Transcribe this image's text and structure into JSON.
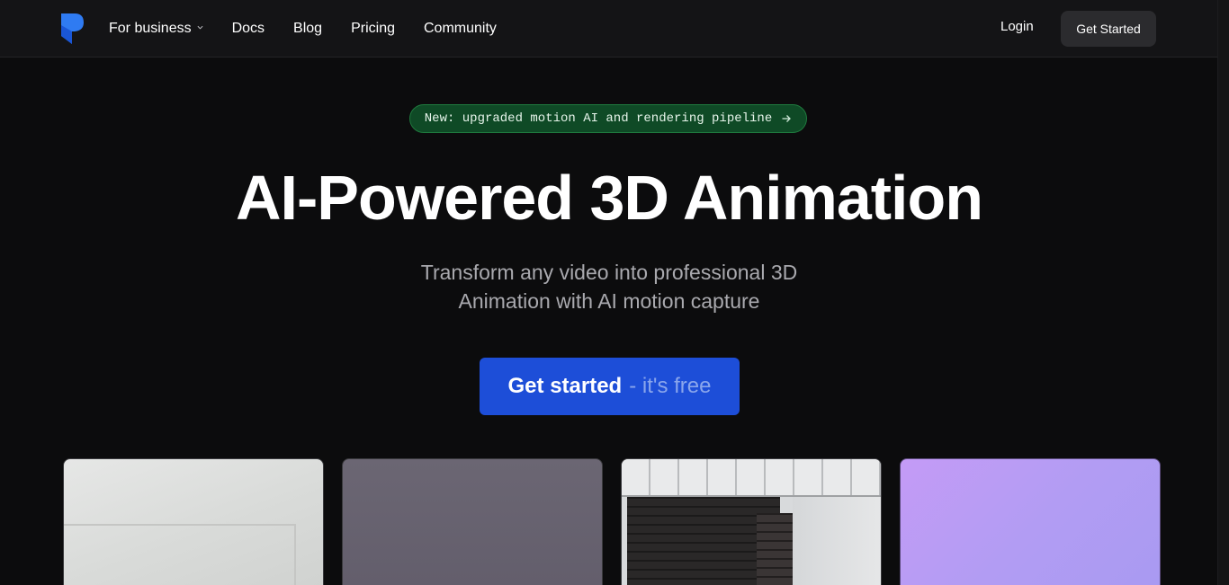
{
  "nav": {
    "logo_icon": "brand-logo-icon",
    "links": [
      {
        "label": "For business",
        "has_dropdown": true
      },
      {
        "label": "Docs"
      },
      {
        "label": "Blog"
      },
      {
        "label": "Pricing"
      },
      {
        "label": "Community"
      }
    ],
    "login_label": "Login",
    "cta_label": "Get Started"
  },
  "hero": {
    "badge_label": "New: upgraded motion AI and rendering pipeline",
    "badge_icon": "arrow-right-icon",
    "title": "AI-Powered 3D Animation",
    "subtitle_line1": "Transform any video into professional 3D",
    "subtitle_line2": "Animation with AI motion capture",
    "cta_main": "Get started",
    "cta_sub": "- it's free"
  },
  "colors": {
    "background": "#0c0c0d",
    "accent": "#1d4ed8",
    "badge_bg": "#0f4a26",
    "logo_blue": "#2563eb"
  },
  "gallery": {
    "cards": [
      {
        "name": "preview-card-door"
      },
      {
        "name": "preview-card-purple-gray"
      },
      {
        "name": "preview-card-brick-wall"
      },
      {
        "name": "preview-card-lavender"
      }
    ]
  }
}
